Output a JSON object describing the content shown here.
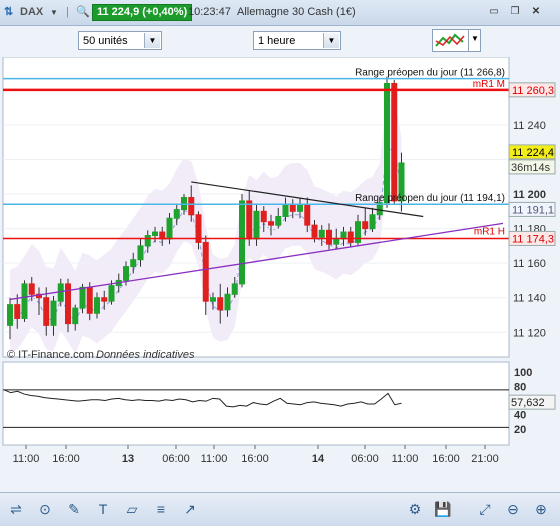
{
  "window": {
    "symbol": "DAX",
    "price_change": "11 224,9 (+0,40%)",
    "time": "10:23:47",
    "instrument": "Allemagne 30 Cash (1€)"
  },
  "toolbar": {
    "units_value": "50 unités",
    "timeframe_value": "1 heure"
  },
  "chart": {
    "copyright": "© IT-Finance.com",
    "disclaimer": "Données indicatives",
    "range_label_high": "Range préopen du jour (11 266,8)",
    "range_label_low": "Range préopen du jour (11 194,1)",
    "mr1_m": "mR1 M",
    "mr1_h": "mR1 H",
    "price_axis": [
      "11 240",
      "11 220",
      "11 200",
      "11 180",
      "11 160",
      "11 140",
      "11 120"
    ],
    "price_tags": {
      "mr1m": "11 260,3",
      "current": "11 224,4",
      "countdown": "36m14s",
      "blue": "11 191,1",
      "mr1h": "11 174,3"
    },
    "osc_axis": [
      "100",
      "80",
      "40",
      "20"
    ],
    "osc_value": "57,632",
    "time_axis": [
      "11:00",
      "16:00",
      "13",
      "06:00",
      "11:00",
      "16:00",
      "14",
      "06:00",
      "11:00",
      "16:00",
      "21:00"
    ],
    "colors": {
      "bull": "#1fa32e",
      "bear": "#e0201f",
      "range": "#4bb6e8",
      "resistance": "#e11",
      "trend": "#8a2fbf"
    }
  },
  "chart_data": {
    "type": "candlestick",
    "title": "",
    "ylim": [
      11108,
      11277
    ],
    "candles": [
      [
        11124,
        11136,
        11116,
        11140
      ],
      [
        11136,
        11128,
        11122,
        11142
      ],
      [
        11128,
        11148,
        11126,
        11150
      ],
      [
        11148,
        11142,
        11138,
        11152
      ],
      [
        11142,
        11140,
        11130,
        11146
      ],
      [
        11140,
        11124,
        11118,
        11146
      ],
      [
        11124,
        11138,
        11118,
        11141
      ],
      [
        11138,
        11148,
        11135,
        11151
      ],
      [
        11148,
        11125,
        11120,
        11151
      ],
      [
        11125,
        11134,
        11121,
        11136
      ],
      [
        11134,
        11146,
        11131,
        11148
      ],
      [
        11146,
        11131,
        11127,
        11149
      ],
      [
        11131,
        11140,
        11128,
        11143
      ],
      [
        11140,
        11138,
        11133,
        11144
      ],
      [
        11138,
        11147,
        11136,
        11150
      ],
      [
        11147,
        11150,
        11143,
        11154
      ],
      [
        11150,
        11158,
        11147,
        11161
      ],
      [
        11158,
        11162,
        11154,
        11166
      ],
      [
        11162,
        11170,
        11158,
        11174
      ],
      [
        11170,
        11176,
        11166,
        11179
      ],
      [
        11176,
        11178,
        11172,
        11181
      ],
      [
        11178,
        11174,
        11170,
        11181
      ],
      [
        11174,
        11186,
        11171,
        11189
      ],
      [
        11186,
        11191,
        11182,
        11194
      ],
      [
        11191,
        11198,
        11188,
        11200
      ],
      [
        11198,
        11188,
        11184,
        11205
      ],
      [
        11188,
        11172,
        11168,
        11190
      ],
      [
        11172,
        11138,
        11130,
        11176
      ],
      [
        11138,
        11140,
        11133,
        11143
      ],
      [
        11140,
        11133,
        11125,
        11148
      ],
      [
        11133,
        11142,
        11129,
        11146
      ],
      [
        11142,
        11148,
        11140,
        11152
      ],
      [
        11148,
        11196,
        11146,
        11200
      ],
      [
        11196,
        11174,
        11170,
        11202
      ],
      [
        11174,
        11190,
        11170,
        11194
      ],
      [
        11190,
        11184,
        11178,
        11193
      ],
      [
        11184,
        11182,
        11176,
        11188
      ],
      [
        11182,
        11187,
        11180,
        11192
      ],
      [
        11187,
        11194,
        11184,
        11198
      ],
      [
        11194,
        11190,
        11186,
        11197
      ],
      [
        11190,
        11194,
        11186,
        11198
      ],
      [
        11194,
        11182,
        11178,
        11198
      ],
      [
        11182,
        11175,
        11172,
        11185
      ],
      [
        11175,
        11179,
        11170,
        11182
      ],
      [
        11179,
        11171,
        11168,
        11183
      ],
      [
        11171,
        11174,
        11168,
        11180
      ],
      [
        11174,
        11178,
        11170,
        11181
      ],
      [
        11178,
        11172,
        11169,
        11181
      ],
      [
        11172,
        11184,
        11170,
        11188
      ],
      [
        11184,
        11180,
        11176,
        11192
      ],
      [
        11180,
        11188,
        11178,
        11192
      ],
      [
        11188,
        11195,
        11185,
        11198
      ],
      [
        11195,
        11264,
        11192,
        11268
      ],
      [
        11264,
        11196,
        11194,
        11266
      ],
      [
        11196,
        11218,
        11190,
        11224
      ]
    ],
    "oscillator": {
      "ylim": [
        0,
        110
      ],
      "values": [
        75,
        71,
        73,
        69,
        67,
        66,
        64,
        63,
        62,
        61,
        60,
        59,
        60,
        61,
        61,
        60,
        62,
        63,
        61,
        60,
        61,
        60,
        60,
        59,
        61,
        60,
        62,
        61,
        58,
        60,
        59,
        63,
        62,
        52,
        51,
        53,
        52,
        57,
        55,
        54,
        59,
        63,
        56,
        55,
        54,
        57,
        58,
        56,
        55,
        54,
        52,
        55,
        56,
        58,
        55,
        55,
        62,
        70,
        54,
        56
      ]
    },
    "reference_lines": {
      "range_high": 11266.8,
      "range_low": 11194.1,
      "mr1_m": 11260.3,
      "mr1_h": 11174.3,
      "osc_high": 75,
      "osc_low": 22
    }
  },
  "bottombar": {
    "icons": [
      "share-icon",
      "crosshair-icon",
      "drawing-icon",
      "text-icon",
      "shapes-icon",
      "lines-icon",
      "arrow-icon",
      "settings-icon",
      "save-icon",
      "zoom-fit-icon",
      "zoom-out-icon",
      "zoom-in-icon"
    ]
  }
}
